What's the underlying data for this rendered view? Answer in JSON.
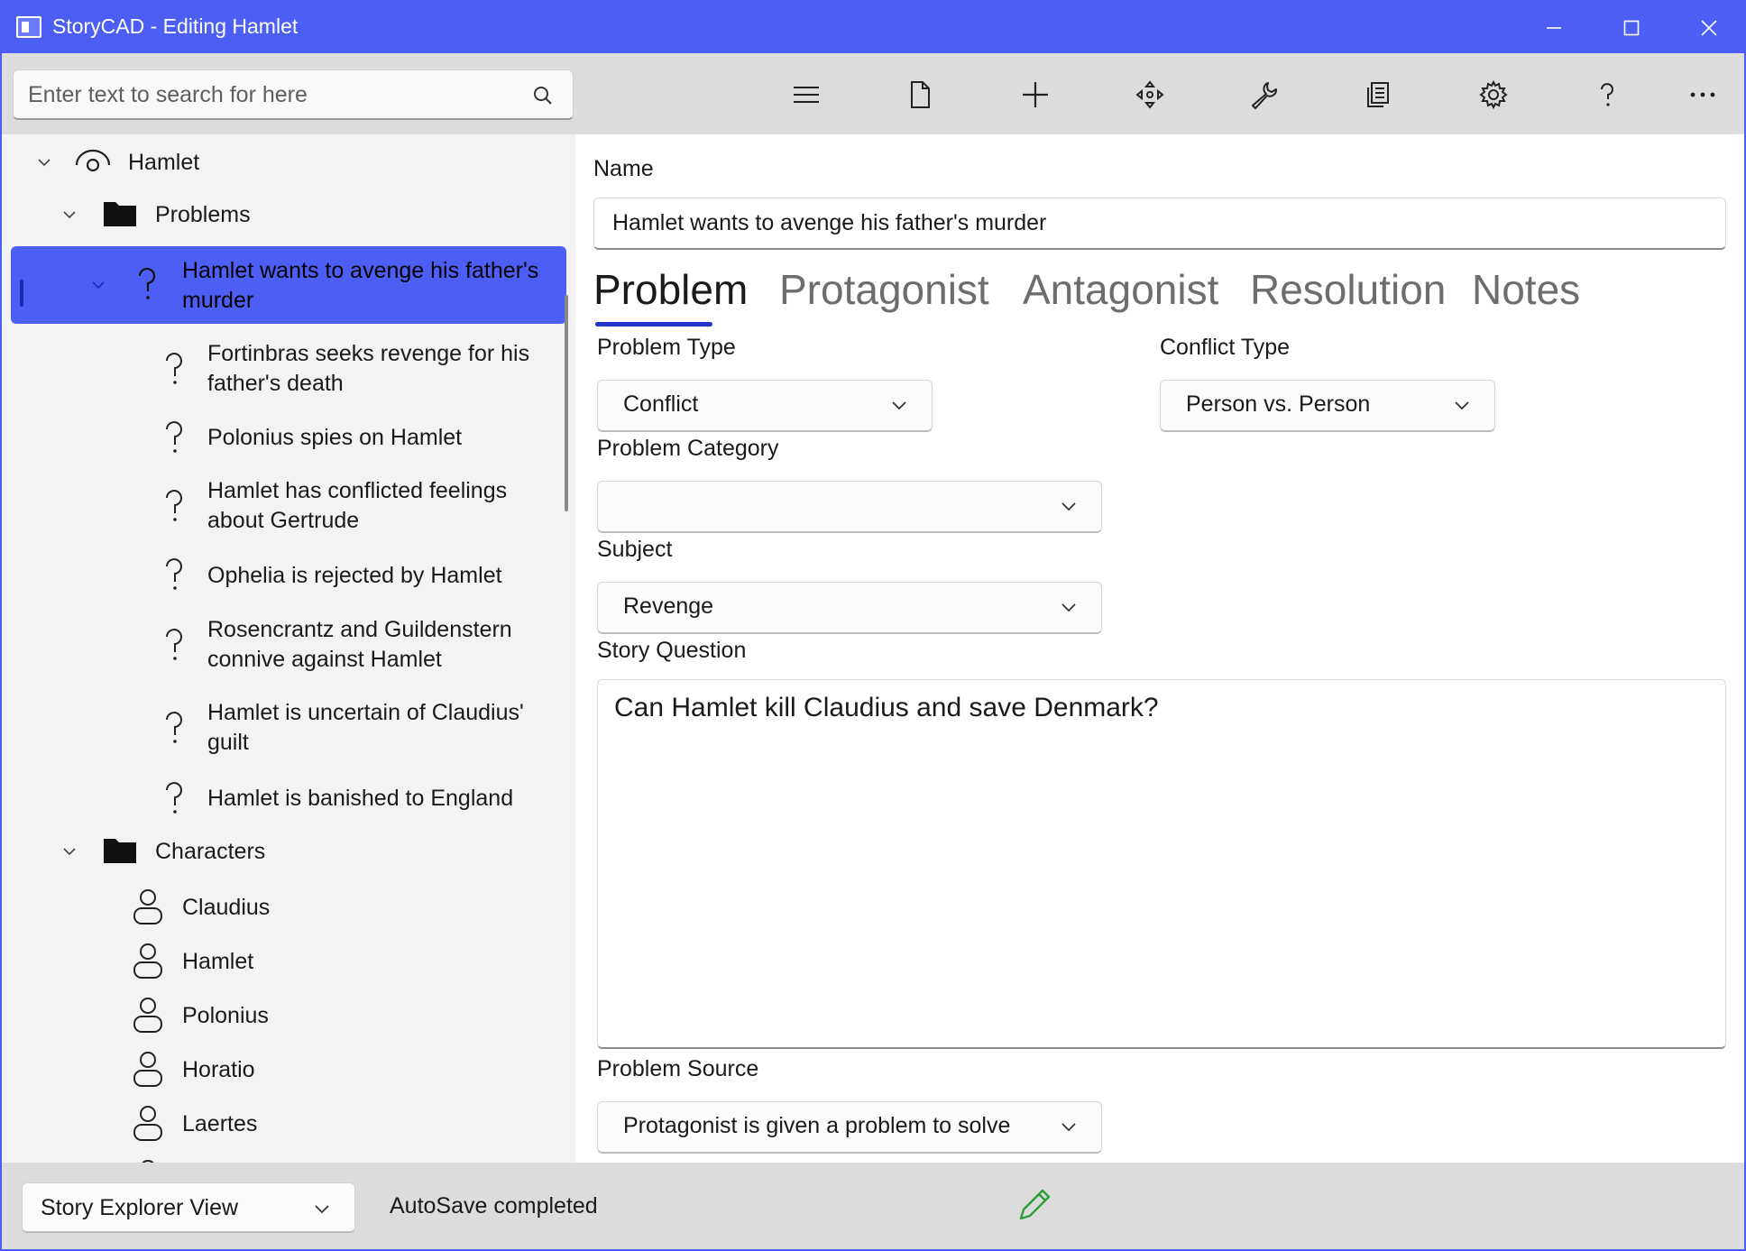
{
  "window": {
    "title": "StoryCAD - Editing Hamlet",
    "accent": "#4d5ef5"
  },
  "search": {
    "placeholder": "Enter text to search for here"
  },
  "toolbar": {
    "icons": [
      "menu-icon",
      "new-file-icon",
      "add-icon",
      "move-icon",
      "tools-icon",
      "reports-icon",
      "settings-icon",
      "help-icon",
      "more-icon"
    ]
  },
  "tree": {
    "root": {
      "label": "Hamlet"
    },
    "problems_folder": {
      "label": "Problems"
    },
    "problems": [
      {
        "label": "Hamlet wants to avenge his father's",
        "label2": "murder",
        "selected": true
      },
      {
        "label": "Fortinbras seeks revenge for his",
        "label2": "father's death"
      },
      {
        "label": "Polonius spies on Hamlet",
        "label2": ""
      },
      {
        "label": "Hamlet has conflicted feelings",
        "label2": "about Gertrude"
      },
      {
        "label": "Ophelia is rejected by Hamlet",
        "label2": ""
      },
      {
        "label": "Rosencrantz and Guildenstern",
        "label2": "connive against Hamlet"
      },
      {
        "label": "Hamlet is uncertain of Claudius'",
        "label2": "guilt"
      },
      {
        "label": "Hamlet is banished to England",
        "label2": ""
      }
    ],
    "characters_folder": {
      "label": "Characters"
    },
    "characters": [
      {
        "label": "Claudius"
      },
      {
        "label": "Hamlet"
      },
      {
        "label": "Polonius"
      },
      {
        "label": "Horatio"
      },
      {
        "label": "Laertes"
      }
    ]
  },
  "form": {
    "name_label": "Name",
    "name_value": "Hamlet wants to avenge his father's murder",
    "tabs": [
      {
        "label": "Problem",
        "active": true
      },
      {
        "label": "Protagonist"
      },
      {
        "label": "Antagonist"
      },
      {
        "label": "Resolution"
      },
      {
        "label": "Notes"
      }
    ],
    "problem_type_label": "Problem Type",
    "problem_type_value": "Conflict",
    "conflict_type_label": "Conflict Type",
    "conflict_type_value": "Person vs. Person",
    "problem_category_label": "Problem Category",
    "problem_category_value": "",
    "subject_label": "Subject",
    "subject_value": "Revenge",
    "story_question_label": "Story Question",
    "story_question_value": "Can Hamlet kill Claudius and save Denmark?",
    "problem_source_label": "Problem Source",
    "problem_source_value": "Protagonist is given a problem to solve"
  },
  "statusbar": {
    "view_value": "AutoSave completed",
    "view_combo": "Story Explorer View",
    "pencil_color": "#2e9e3a"
  }
}
